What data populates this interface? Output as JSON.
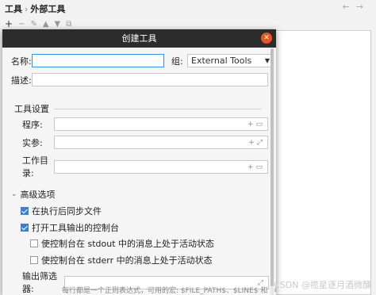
{
  "header": {
    "crumb_root": "工具",
    "crumb_sep": "›",
    "crumb_current": "外部工具"
  },
  "nav": {
    "back": "←",
    "forward": "→"
  },
  "toolbar": {
    "add": "+",
    "remove": "−",
    "edit": "✎",
    "up": "▲",
    "down": "▼",
    "copy": "⧉"
  },
  "dialog": {
    "title": "创建工具",
    "close_glyph": "✕",
    "name_label": "名称:",
    "name_value": "",
    "group_label": "组:",
    "group_value": "External Tools",
    "desc_label": "描述:",
    "desc_value": "",
    "tool_settings": "工具设置",
    "program_label": "程序:",
    "args_label": "实参:",
    "workdir_label": "工作目录:",
    "advanced": "高级选项",
    "sync_label": "在执行后同步文件",
    "console_label": "打开工具输出的控制台",
    "stdout_label": "使控制台在 stdout 中的消息上处于活动状态",
    "stderr_label": "使控制台在 stderr 中的消息上处于活动状态",
    "filter_label": "输出筛选器:",
    "hint": "每行都是一个正则表达式，可用的宏: $FILE_PATH$、$LINE$ 和 $COLUMN$",
    "icons": {
      "plus": "+",
      "folder": "▭",
      "expand": "⤢"
    },
    "checkboxes": {
      "sync": true,
      "console": true,
      "stdout": false,
      "stderr": false
    }
  },
  "watermark": "CSDN @揽星逐月酒微醺"
}
